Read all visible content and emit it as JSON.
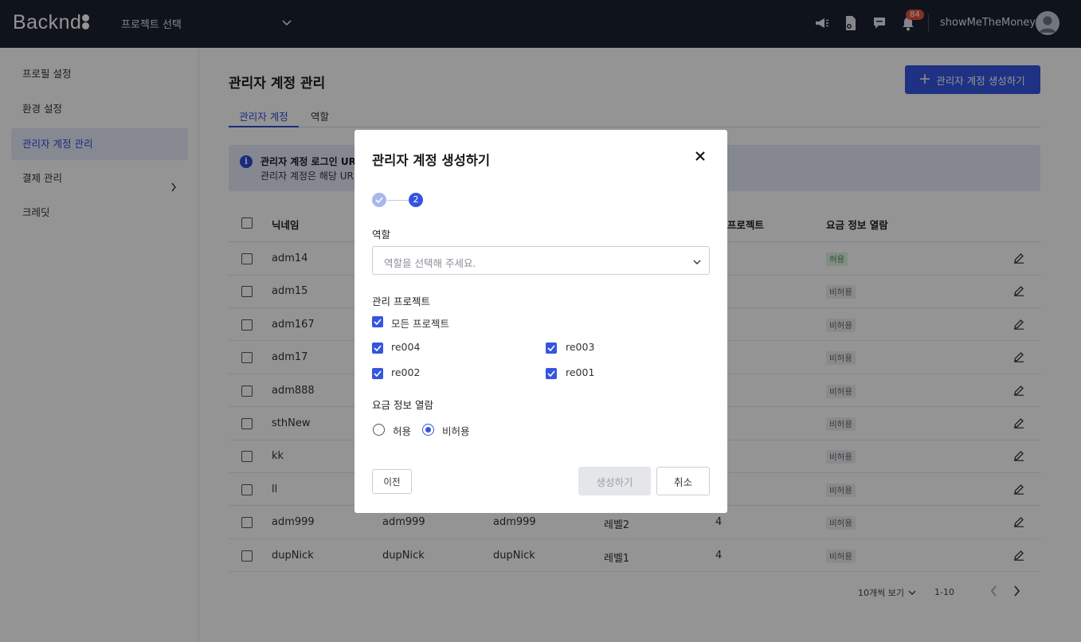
{
  "header": {
    "logo": "Backnd",
    "project_select": "프로젝트 선택",
    "notification_count": "84",
    "username": "showMeTheMoney"
  },
  "sidebar": {
    "items": [
      {
        "label": "프로필 설정"
      },
      {
        "label": "환경 설정"
      },
      {
        "label": "관리자 계정 관리"
      },
      {
        "label": "결제 관리"
      },
      {
        "label": "크레딧"
      }
    ]
  },
  "main": {
    "title": "관리자 계정 관리",
    "create_button": "관리자 계정 생성하기",
    "tabs": [
      {
        "label": "관리자 계정"
      },
      {
        "label": "역할"
      }
    ],
    "info": {
      "line1": "관리자 계정 로그인 URL",
      "line2": "관리자 계정은 해당 URL"
    },
    "table": {
      "headers": {
        "nickname": "닉네임",
        "projects": "리 프로젝트",
        "billing": "요금 정보 열람"
      },
      "rows": [
        {
          "nickname": "adm14",
          "billing": "허용"
        },
        {
          "nickname": "adm15",
          "billing": "비허용"
        },
        {
          "nickname": "adm167",
          "billing": "비허용"
        },
        {
          "nickname": "adm17",
          "billing": "비허용"
        },
        {
          "nickname": "adm888",
          "billing": "비허용"
        },
        {
          "nickname": "sthNew",
          "billing": "비허용"
        },
        {
          "nickname": "kk",
          "billing": "비허용"
        },
        {
          "nickname": "ll",
          "billing": "비허용"
        },
        {
          "nickname": "adm999",
          "id": "adm999",
          "name": "adm999",
          "role": "레벨2",
          "projects": "4",
          "billing": "비허용"
        },
        {
          "nickname": "dupNick",
          "id": "dupNick",
          "name": "dupNick",
          "role": "레벨1",
          "projects": "4",
          "billing": "비허용"
        }
      ]
    },
    "pager": {
      "page_size": "10개씩 보기",
      "range": "1-10"
    }
  },
  "modal": {
    "title": "관리자 계정 생성하기",
    "step_current": "2",
    "role_label": "역할",
    "role_placeholder": "역할을 선택해 주세요.",
    "projects_label": "관리 프로젝트",
    "all_projects": "모든 프로젝트",
    "projects": [
      "re004",
      "re003",
      "re002",
      "re001"
    ],
    "billing_label": "요금 정보 열람",
    "billing_options": [
      "허용",
      "비허용"
    ],
    "billing_selected": "비허용",
    "prev_button": "이전",
    "create_button": "생성하기",
    "cancel_button": "취소"
  },
  "colors": {
    "topbar": "#1b2131",
    "accent": "#3555e0",
    "badge": "#e2553e"
  }
}
